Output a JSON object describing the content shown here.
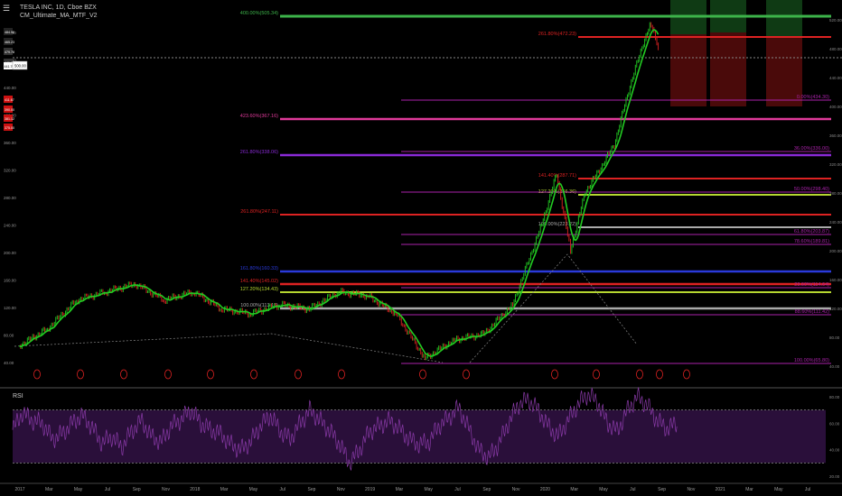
{
  "legend": {
    "symbol_line": "TESLA INC, 1D, Cboe BZX",
    "indicator_line": "CM_Ultimate_MA_MTF_V2",
    "rsi_label": "RSI"
  },
  "colors": {
    "background": "#000000",
    "price_up": "#22cc22",
    "price_down": "#dd2222",
    "ma_line": "#22cc22",
    "rsi_line": "#8a3aa8",
    "rsi_band": "#2a0f3a"
  },
  "chart_data": [
    {
      "type": "line",
      "title": "TESLA INC, 1D, Cboe BZX",
      "yscale": "log",
      "price_axis_ticks": [
        "520.00",
        "480.00",
        "440.00",
        "400.00",
        "360.00",
        "320.00",
        "280.00",
        "240.00",
        "200.00",
        "160.00",
        "120.00",
        "80.00",
        "40.00"
      ],
      "price_badges": [
        "484.50",
        "465.23",
        "479.78",
        "441.76",
        "411.67",
        "390.00",
        "381.12",
        "375.00"
      ],
      "current_price_tag": "441.76",
      "current_price_box": "500.00",
      "x_labels": [
        "2017",
        "Mar",
        "May",
        "Jul",
        "Sep",
        "Nov",
        "2018",
        "Mar",
        "May",
        "Jul",
        "Sep",
        "Nov",
        "2019",
        "Mar",
        "May",
        "Jul",
        "Sep",
        "Nov",
        "2020",
        "Mar",
        "May",
        "Jul",
        "Sep",
        "Nov",
        "2021",
        "Mar",
        "May",
        "Jul"
      ],
      "price_series": [
        {
          "x": "2017-01",
          "y": 44
        },
        {
          "x": "2017-03",
          "y": 50
        },
        {
          "x": "2017-05",
          "y": 62
        },
        {
          "x": "2017-07",
          "y": 66
        },
        {
          "x": "2017-09",
          "y": 70
        },
        {
          "x": "2017-11",
          "y": 62
        },
        {
          "x": "2018-01",
          "y": 66
        },
        {
          "x": "2018-03",
          "y": 58
        },
        {
          "x": "2018-05",
          "y": 56
        },
        {
          "x": "2018-07",
          "y": 60
        },
        {
          "x": "2018-09",
          "y": 58
        },
        {
          "x": "2018-11",
          "y": 66
        },
        {
          "x": "2019-01",
          "y": 64
        },
        {
          "x": "2019-03",
          "y": 56
        },
        {
          "x": "2019-05",
          "y": 40
        },
        {
          "x": "2019-07",
          "y": 46
        },
        {
          "x": "2019-09",
          "y": 48
        },
        {
          "x": "2019-11",
          "y": 60
        },
        {
          "x": "2020-01",
          "y": 110
        },
        {
          "x": "2020-02",
          "y": 160
        },
        {
          "x": "2020-03",
          "y": 90
        },
        {
          "x": "2020-04",
          "y": 140
        },
        {
          "x": "2020-05",
          "y": 165
        },
        {
          "x": "2020-06",
          "y": 200
        },
        {
          "x": "2020-07",
          "y": 300
        },
        {
          "x": "2020-08",
          "y": 430
        },
        {
          "x": "2020-08-31",
          "y": 498
        },
        {
          "x": "2020-09",
          "y": 410
        }
      ],
      "fib_levels": [
        {
          "label": "400.00%(505.34)",
          "color": "#3db34a"
        },
        {
          "label": "261.80%(472.23)",
          "color": "#dd2222"
        },
        {
          "label": "0.00%(434.30)",
          "color": "#aa22aa"
        },
        {
          "label": "423.60%(367.16)",
          "color": "#e03a9a"
        },
        {
          "label": "261.80%(338.06)",
          "color": "#8a2ad6"
        },
        {
          "label": "36.00%(336.00)",
          "color": "#aa22aa"
        },
        {
          "label": "141.40%(287.71)",
          "color": "#dd2222"
        },
        {
          "label": "127.20%(266.36)",
          "color": "#b5d630"
        },
        {
          "label": "50.00%(298.40)",
          "color": "#aa22aa"
        },
        {
          "label": "261.80%(247.11)",
          "color": "#dd2222"
        },
        {
          "label": "100.00%(223.22)",
          "color": "#aaaaaa"
        },
        {
          "label": "61.80%(203.87)",
          "color": "#aa22aa"
        },
        {
          "label": "78.60%(189.81)",
          "color": "#aa22aa"
        },
        {
          "label": "161.80%(160.33)",
          "color": "#2a3adb"
        },
        {
          "label": "141.40%(145.02)",
          "color": "#dd2222"
        },
        {
          "label": "127.20%(134.43)",
          "color": "#b5d630"
        },
        {
          "label": "100.00%(113.10)",
          "color": "#aaaaaa"
        },
        {
          "label": "23.60%(114.64)",
          "color": "#aa22aa"
        },
        {
          "label": "88.60%(111.42)",
          "color": "#aa22aa"
        },
        {
          "label": "100.00%(65.80)",
          "color": "#aa22aa"
        }
      ]
    },
    {
      "type": "line",
      "title": "RSI",
      "ylim": [
        20,
        80
      ],
      "ticks": [
        "80.00",
        "60.00",
        "40.00",
        "20.00"
      ],
      "levels": [
        70,
        30
      ],
      "series": [
        {
          "values": [
            55,
            68,
            62,
            60,
            48,
            52,
            60,
            66,
            57,
            45,
            50,
            42,
            54,
            62,
            50,
            46,
            58,
            63,
            70,
            60,
            55,
            52,
            44,
            40,
            46,
            58,
            66,
            54,
            48,
            60,
            70,
            62,
            54,
            44,
            30,
            40,
            54,
            58,
            62,
            56,
            48,
            44,
            46,
            58,
            64,
            72,
            56,
            40,
            34,
            44,
            60,
            74,
            78,
            70,
            58,
            50,
            62,
            74,
            82,
            76,
            60,
            54,
            70,
            80,
            74,
            62,
            56,
            60
          ]
        }
      ]
    }
  ]
}
